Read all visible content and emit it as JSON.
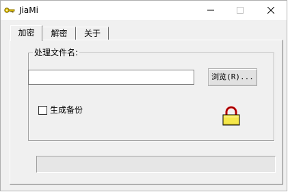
{
  "window": {
    "title": "JiaMi",
    "minimize_icon": "minimize-icon",
    "maximize_icon": "maximize-icon",
    "close_icon": "close-icon"
  },
  "tabs": [
    {
      "label": "加密",
      "active": true
    },
    {
      "label": "解密",
      "active": false
    },
    {
      "label": "关于",
      "active": false
    }
  ],
  "encrypt": {
    "group_label": "处理文件名:",
    "file_input": {
      "value": "",
      "placeholder": ""
    },
    "browse_label": "浏览(R)...",
    "backup_label": "生成备份",
    "backup_checked": false,
    "lock_icon": "padlock-icon"
  },
  "progress": {
    "value": 0
  },
  "colors": {
    "window_bg": "#f0f0f0",
    "titlebar_bg": "#ffffff",
    "lock_body": "#f5e74a",
    "lock_shackle": "#d40000"
  }
}
